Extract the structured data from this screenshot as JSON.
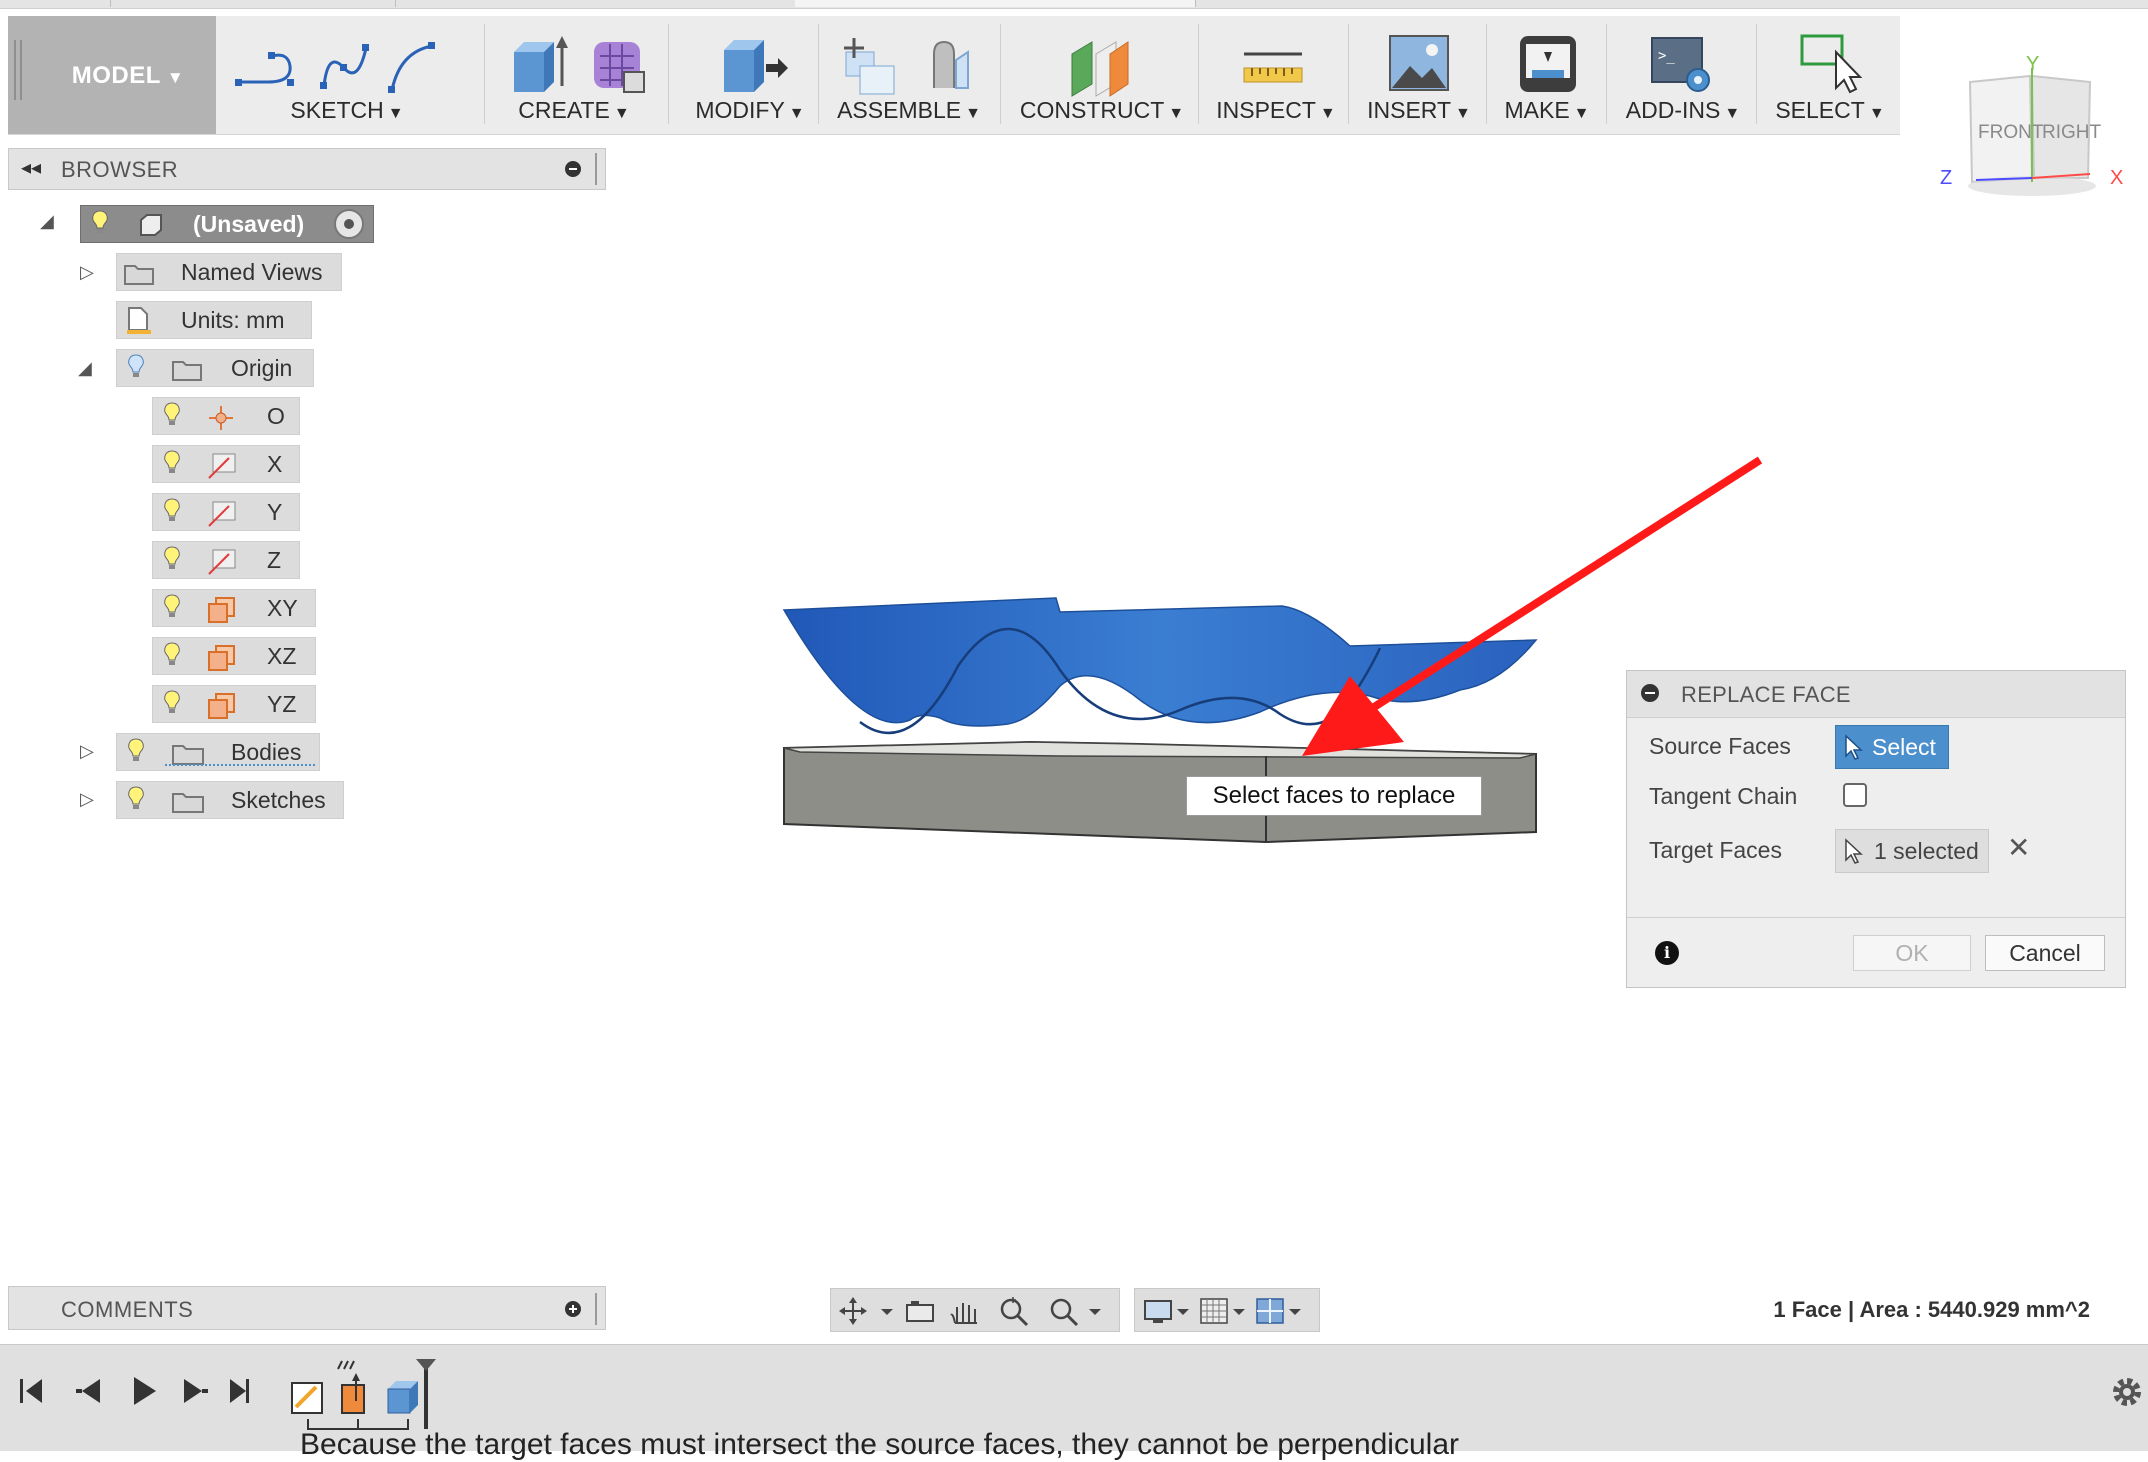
{
  "toolbar": {
    "workspace": "MODEL",
    "groups": [
      {
        "label": "SKETCH"
      },
      {
        "label": "CREATE"
      },
      {
        "label": "MODIFY"
      },
      {
        "label": "ASSEMBLE"
      },
      {
        "label": "CONSTRUCT"
      },
      {
        "label": "INSPECT"
      },
      {
        "label": "INSERT"
      },
      {
        "label": "MAKE"
      },
      {
        "label": "ADD-INS"
      },
      {
        "label": "SELECT"
      }
    ]
  },
  "viewcube": {
    "front": "FRONT",
    "right": "RIGHT",
    "axis_x": "X",
    "axis_y": "Y",
    "axis_z": "Z"
  },
  "browser": {
    "title": "BROWSER",
    "root": "(Unsaved)",
    "items": [
      {
        "label": "Named Views"
      },
      {
        "label": "Units: mm"
      },
      {
        "label": "Origin"
      },
      {
        "label": "O"
      },
      {
        "label": "X"
      },
      {
        "label": "Y"
      },
      {
        "label": "Z"
      },
      {
        "label": "XY"
      },
      {
        "label": "XZ"
      },
      {
        "label": "YZ"
      },
      {
        "label": "Bodies"
      },
      {
        "label": "Sketches"
      }
    ]
  },
  "comments": {
    "title": "COMMENTS"
  },
  "status": {
    "text": "1 Face | Area : 5440.929 mm^2"
  },
  "tooltip": {
    "text": "Select faces to replace"
  },
  "dialog": {
    "title": "REPLACE FACE",
    "source_faces_label": "Source Faces",
    "select_button": "Select",
    "tangent_chain_label": "Tangent Chain",
    "tangent_chain_checked": false,
    "target_faces_label": "Target Faces",
    "target_button": "1 selected",
    "ok": "OK",
    "cancel": "Cancel"
  },
  "page_footer_text": "Because the target faces must intersect the source faces, they cannot be perpendicular",
  "colors": {
    "accent": "#4b8fcc",
    "surface": "#2f6fc2",
    "arrow": "#ff1a1a",
    "body": "#8b8b85"
  }
}
